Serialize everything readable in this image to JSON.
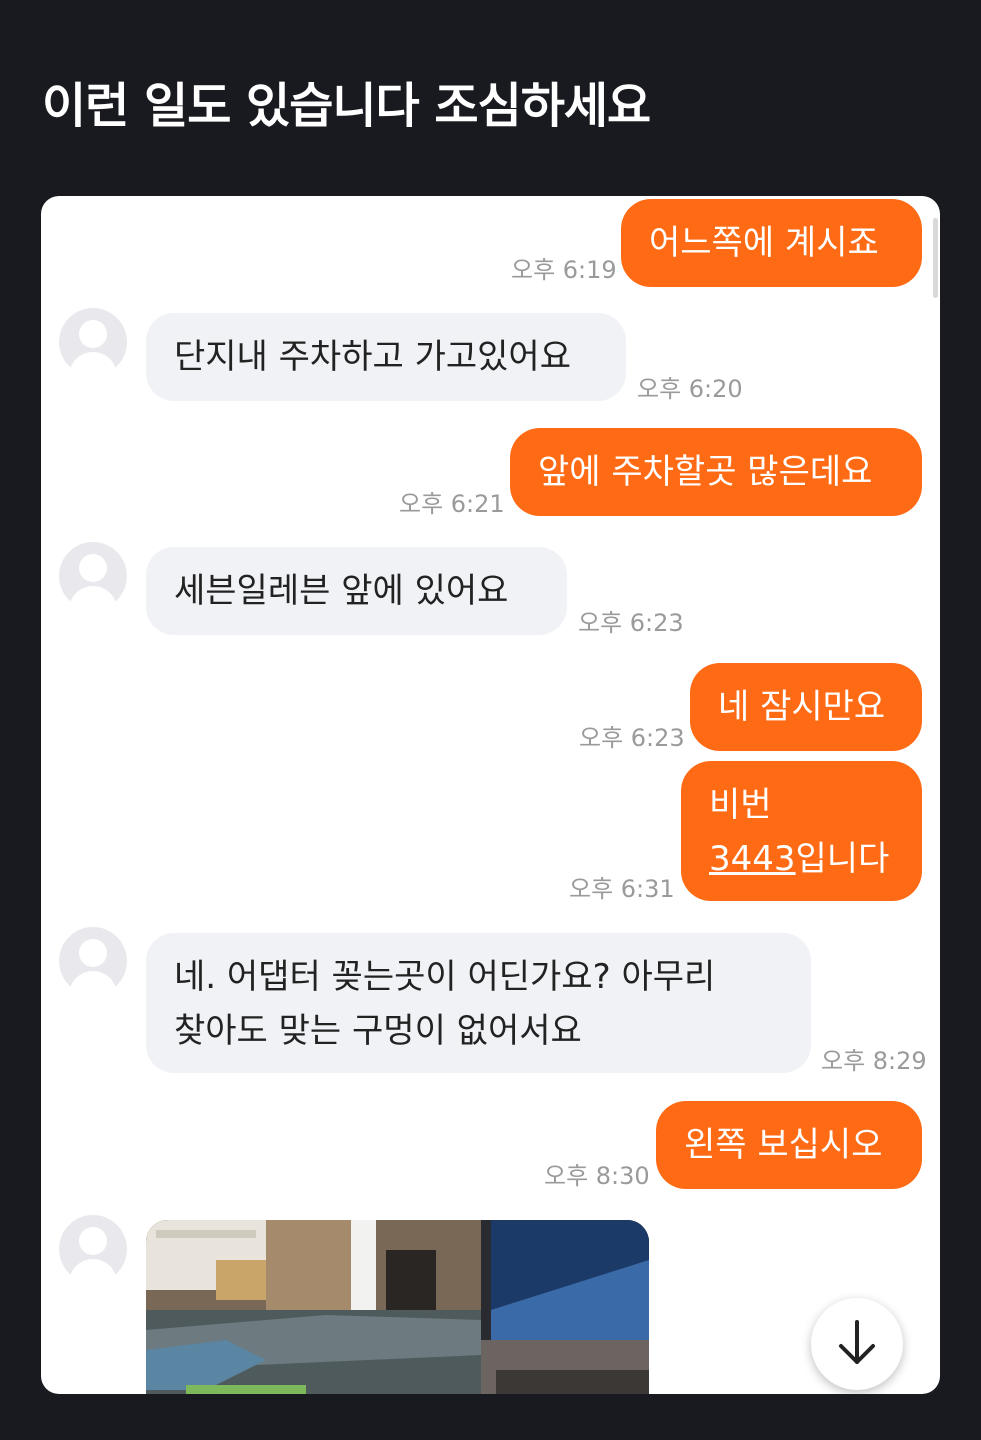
{
  "post": {
    "title": "이런 일도 있습니다 조심하세요"
  },
  "messages": [
    {
      "side": "out",
      "lines": [
        "어느쪽에 계시죠"
      ],
      "time": "오후 6:19"
    },
    {
      "side": "in",
      "lines": [
        "단지내 주차하고 가고있어요"
      ],
      "time": "오후 6:20"
    },
    {
      "side": "out",
      "lines": [
        "앞에 주차할곳 많은데요"
      ],
      "time": "오후 6:21"
    },
    {
      "side": "in",
      "lines": [
        "세븐일레븐 앞에 있어요"
      ],
      "time": "오후 6:23"
    },
    {
      "side": "out",
      "lines": [
        "네 잠시만요"
      ],
      "time": "오후 6:23"
    },
    {
      "side": "out",
      "lines": [
        "비번"
      ],
      "number": "3443",
      "suffix": "입니다",
      "time": "오후 6:31"
    },
    {
      "side": "in",
      "lines": [
        "네. 어댑터 꽂는곳이 어딘가요? 아무리",
        "찾아도 맞는 구멍이 없어서요"
      ],
      "time": "오후 8:29"
    },
    {
      "side": "out",
      "lines": [
        "왼쪽 보십시오"
      ],
      "time": "오후 8:30"
    }
  ],
  "icons": {
    "avatar": "default-profile-avatar-icon",
    "scroll_down": "arrow-down-icon"
  },
  "colors": {
    "background": "#181a20",
    "outgoing_bubble": "#ff6a14",
    "incoming_bubble": "#f1f2f6",
    "timestamp": "#9a9a9a"
  }
}
